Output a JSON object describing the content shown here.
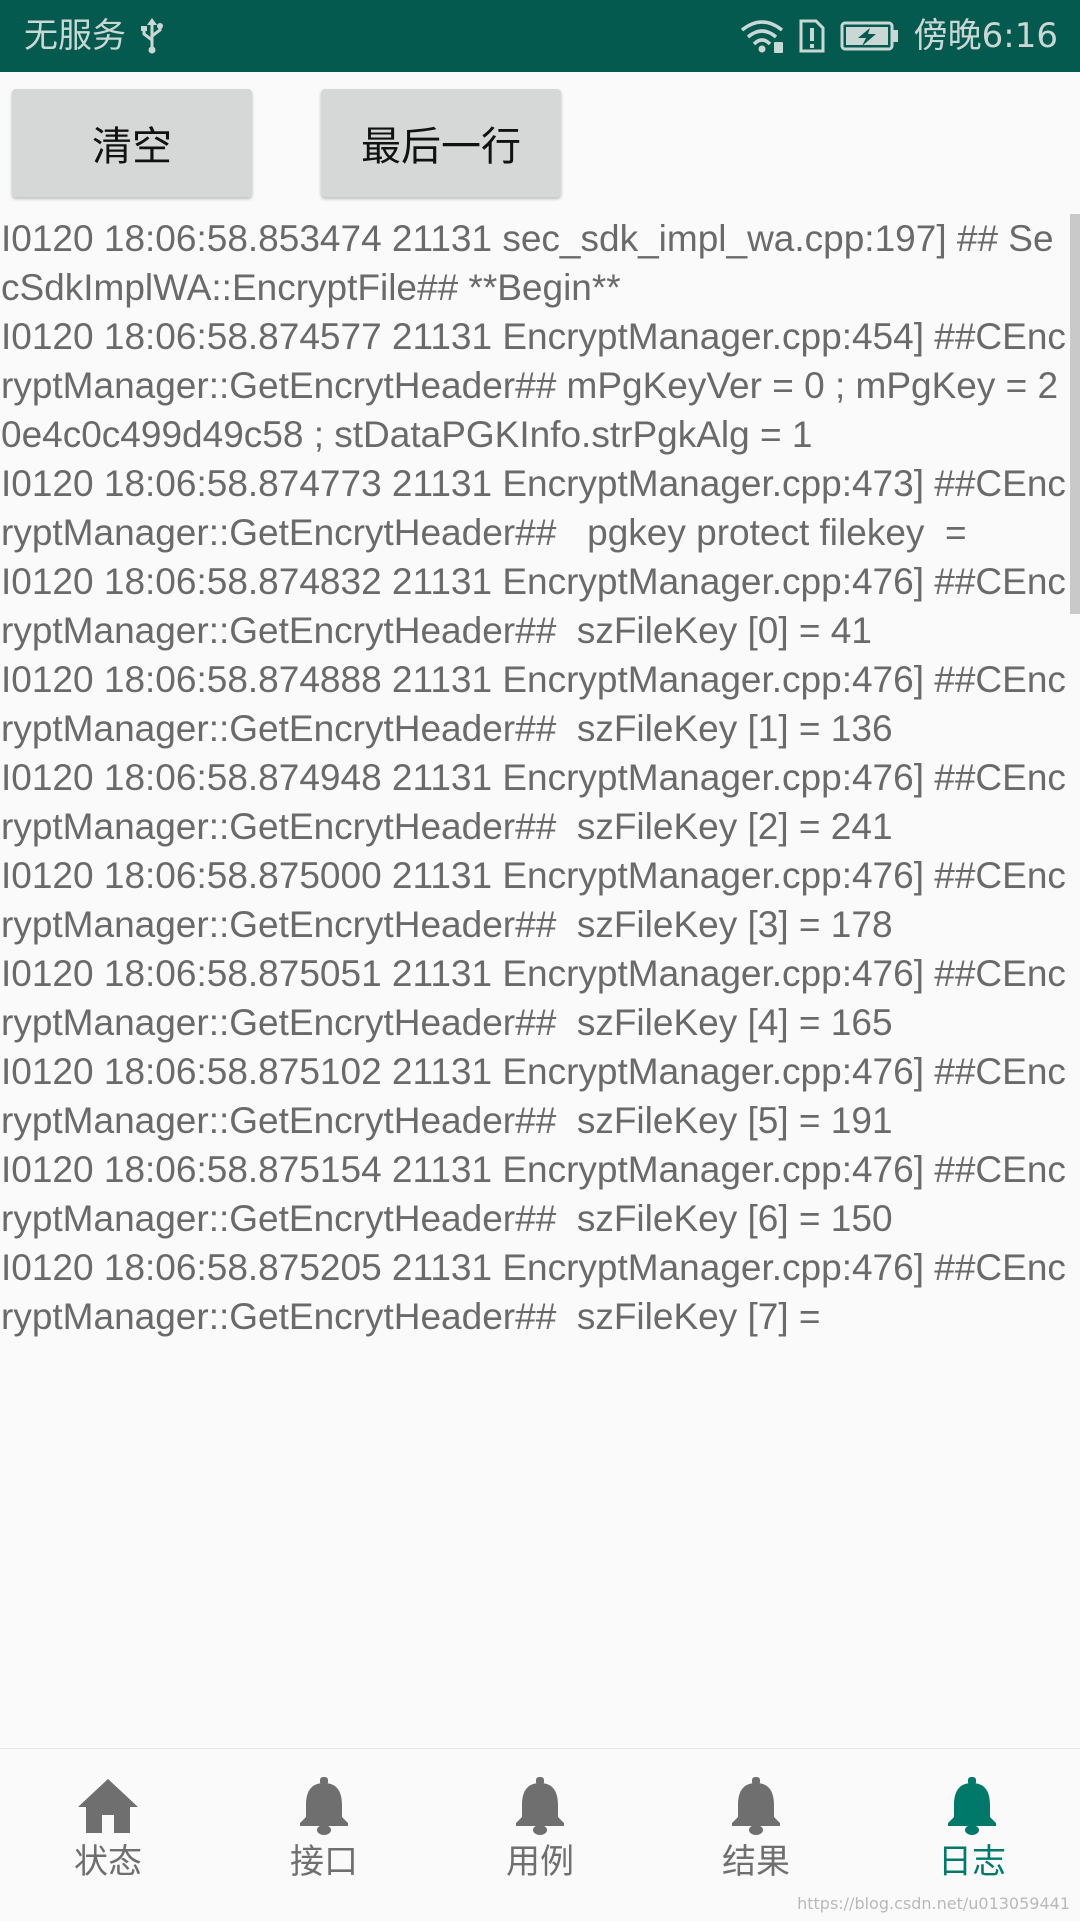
{
  "status_bar": {
    "carrier": "无服务",
    "time": "傍晚6:16",
    "icons": [
      "usb-icon",
      "wifi-icon",
      "alert-icon",
      "battery-charging-icon"
    ]
  },
  "toolbar": {
    "clear_label": "清空",
    "last_line_label": "最后一行"
  },
  "log": {
    "text": "I0120 18:06:58.853474 21131 sec_sdk_impl_wa.cpp:197] ## SecSdkImplWA::EncryptFile## **Begin**\nI0120 18:06:58.874577 21131 EncryptManager.cpp:454] ##CEncryptManager::GetEncrytHeader## mPgKeyVer = 0 ; mPgKey = 20e4c0c499d49c58 ; stDataPGKInfo.strPgkAlg = 1\nI0120 18:06:58.874773 21131 EncryptManager.cpp:473] ##CEncryptManager::GetEncrytHeader##   pgkey protect filekey  =\nI0120 18:06:58.874832 21131 EncryptManager.cpp:476] ##CEncryptManager::GetEncrytHeader##  szFileKey [0] = 41\nI0120 18:06:58.874888 21131 EncryptManager.cpp:476] ##CEncryptManager::GetEncrytHeader##  szFileKey [1] = 136\nI0120 18:06:58.874948 21131 EncryptManager.cpp:476] ##CEncryptManager::GetEncrytHeader##  szFileKey [2] = 241\nI0120 18:06:58.875000 21131 EncryptManager.cpp:476] ##CEncryptManager::GetEncrytHeader##  szFileKey [3] = 178\nI0120 18:06:58.875051 21131 EncryptManager.cpp:476] ##CEncryptManager::GetEncrytHeader##  szFileKey [4] = 165\nI0120 18:06:58.875102 21131 EncryptManager.cpp:476] ##CEncryptManager::GetEncrytHeader##  szFileKey [5] = 191\nI0120 18:06:58.875154 21131 EncryptManager.cpp:476] ##CEncryptManager::GetEncrytHeader##  szFileKey [6] = 150\nI0120 18:06:58.875205 21131 EncryptManager.cpp:476] ##CEncryptManager::GetEncrytHeader##  szFileKey [7] ="
  },
  "bottom_nav": {
    "items": [
      {
        "label": "状态",
        "icon": "home-icon",
        "active": false
      },
      {
        "label": "接口",
        "icon": "bell-icon",
        "active": false
      },
      {
        "label": "用例",
        "icon": "bell-icon",
        "active": false
      },
      {
        "label": "结果",
        "icon": "bell-icon",
        "active": false
      },
      {
        "label": "日志",
        "icon": "bell-icon",
        "active": true
      }
    ]
  },
  "watermark": "https://blog.csdn.net/u013059441",
  "colors": {
    "status_bar": "#045a4f",
    "accent": "#00796b",
    "button": "#d6d7d7",
    "log_text": "#6a6a6a"
  }
}
